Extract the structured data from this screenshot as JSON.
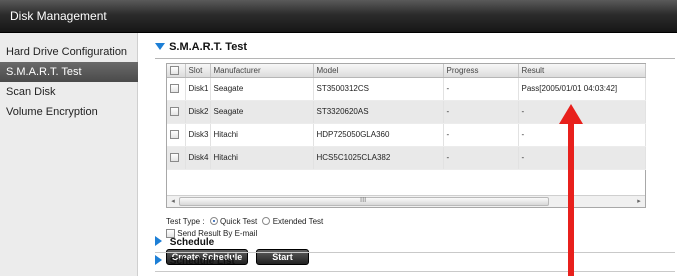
{
  "window": {
    "title": "Disk Management"
  },
  "sidebar": {
    "items": [
      {
        "label": "Hard Drive Configuration",
        "active": false
      },
      {
        "label": "S.M.A.R.T. Test",
        "active": true
      },
      {
        "label": "Scan Disk",
        "active": false
      },
      {
        "label": "Volume Encryption",
        "active": false
      }
    ]
  },
  "main": {
    "section_title": "S.M.A.R.T. Test",
    "table": {
      "columns": [
        "Slot",
        "Manufacturer",
        "Model",
        "Progress",
        "Result"
      ],
      "rows": [
        {
          "slot": "Disk1",
          "manufacturer": "Seagate",
          "model": "ST3500312CS",
          "progress": "-",
          "result": "Pass[2005/01/01 04:03:42]"
        },
        {
          "slot": "Disk2",
          "manufacturer": "Seagate",
          "model": "ST3320620AS",
          "progress": "-",
          "result": "-"
        },
        {
          "slot": "Disk3",
          "manufacturer": "Hitachi",
          "model": "HDP725050GLA360",
          "progress": "-",
          "result": "-"
        },
        {
          "slot": "Disk4",
          "manufacturer": "Hitachi",
          "model": "HCS5C1025CLA382",
          "progress": "-",
          "result": "-"
        }
      ],
      "scroll_thumb_label": "III"
    },
    "test_type": {
      "label": "Test Type :",
      "options": [
        "Quick Test",
        "Extended Test"
      ],
      "selected": "Quick Test"
    },
    "send_result_label": "Send Result By E-mail",
    "buttons": {
      "create_schedule": "Create Schedule",
      "start": "Start"
    },
    "schedule_label": "Schedule",
    "schedule_list_label": "Schedule List"
  },
  "colors": {
    "accent_blue": "#1d7fd6",
    "arrow_red": "#e8201c",
    "active_sidebar": "#555555"
  },
  "icons": {
    "expanded": "triangle-down-icon",
    "collapsed": "triangle-right-icon",
    "annotation": "red-up-arrow-icon"
  }
}
